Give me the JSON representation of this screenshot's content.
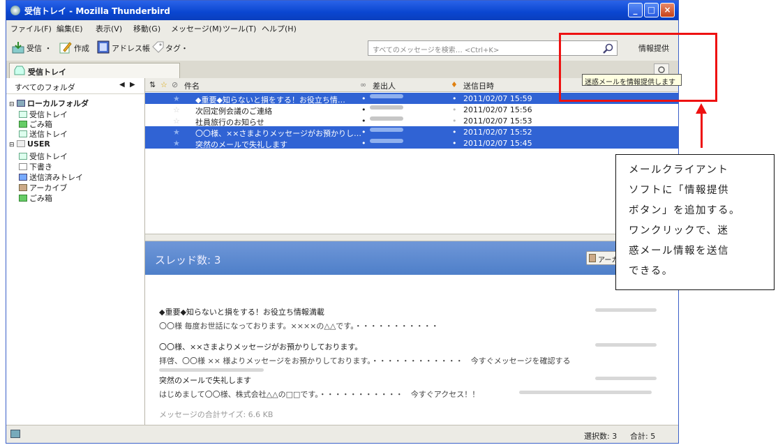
{
  "window": {
    "title": "受信トレイ - Mozilla Thunderbird"
  },
  "menubar": [
    "ファイル(F)",
    "編集(E)",
    "表示(V)",
    "移動(G)",
    "メッセージ(M)",
    "ツール(T)",
    "ヘルプ(H)"
  ],
  "toolbar": {
    "get_label": "受信 ・",
    "write_label": "作成",
    "address_label": "アドレス帳",
    "tag_label": "タグ・",
    "search_placeholder": "すべてのメッセージを検索… <Ctrl+K>",
    "report_label": "情報提供"
  },
  "tab": {
    "label": "受信トレイ"
  },
  "folders": {
    "header": "すべてのフォルダ",
    "items": [
      {
        "label": "ローカルフォルダ",
        "level": 0,
        "bold": true,
        "icon": "local-folders-icon"
      },
      {
        "label": "受信トレイ",
        "level": 1,
        "icon": "inbox-icon"
      },
      {
        "label": "ごみ箱",
        "level": 1,
        "icon": "trash-icon"
      },
      {
        "label": "送信トレイ",
        "level": 1,
        "icon": "outbox-icon"
      },
      {
        "label": "USER",
        "level": 0,
        "bold": true,
        "icon": "account-icon"
      },
      {
        "label": "受信トレイ",
        "level": 1,
        "icon": "inbox-icon"
      },
      {
        "label": "下書き",
        "level": 1,
        "icon": "drafts-icon"
      },
      {
        "label": "送信済みトレイ",
        "level": 1,
        "icon": "sent-icon"
      },
      {
        "label": "アーカイブ",
        "level": 1,
        "icon": "archive-icon"
      },
      {
        "label": "ごみ箱",
        "level": 1,
        "icon": "trash-icon"
      }
    ]
  },
  "columns": {
    "subject": "件名",
    "sender": "差出人",
    "date": "送信日時"
  },
  "messages": [
    {
      "subject": "◆重要◆知らないと損をする！お役立ち情…",
      "date": "2011/02/07 15:59",
      "selected": true
    },
    {
      "subject": "次回定例会議のご連絡",
      "date": "2011/02/07 15:56",
      "selected": false
    },
    {
      "subject": "社員旅行のお知らせ",
      "date": "2011/02/07 15:53",
      "selected": false
    },
    {
      "subject": "〇〇様、××さまよりメッセージがお預かりし…",
      "date": "2011/02/07 15:52",
      "selected": true
    },
    {
      "subject": "突然のメールで失礼します",
      "date": "2011/02/07 15:45",
      "selected": true
    }
  ],
  "preview": {
    "thread_count": "スレッド数: 3",
    "archive_label": "アーカ",
    "items": [
      {
        "subject": "◆重要◆知らないと損をする！お役立ち情報満載",
        "body": "〇〇様 毎度お世話になっております。××××の△△です。・・・・・・・・・・・"
      },
      {
        "subject": "〇〇様、××さまよりメッセージがお預かりしております。",
        "body": "拝啓、〇〇様 ×× 様よりメッセージをお預かりしております。・・・・・・・・・・・・　今すぐメッセージを確認する"
      },
      {
        "subject": "突然のメールで失礼します",
        "body": "はじめまして〇〇様、株式会社△△の□□です。・・・・・・・・・・・　今すぐアクセス！！"
      }
    ],
    "total_size": "メッセージの合計サイズ: 6.6 KB"
  },
  "status": {
    "selected": "選択数: 3",
    "total": "合計: 5"
  },
  "tooltip": "迷惑メールを情報提供します",
  "callout": {
    "lines": [
      "メールクライアント",
      "ソフトに「情報提供",
      "ボタン」を追加する。",
      "ワンクリックで、迷",
      "惑メール情報を送信",
      "できる。"
    ]
  },
  "colors": {
    "selection": "#3063d4",
    "titlebar": "#0a46d0",
    "highlight": "#ee1111"
  }
}
